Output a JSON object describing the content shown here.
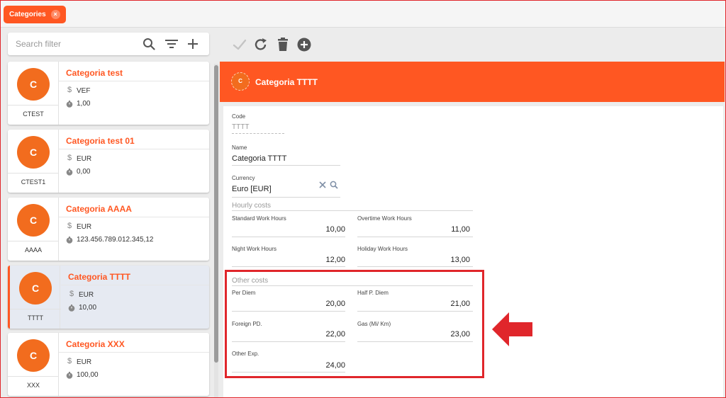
{
  "tab": {
    "label": "Categories",
    "close": "×"
  },
  "search": {
    "placeholder": "Search filter"
  },
  "toolbar": {
    "icons": [
      "check-icon",
      "refresh-icon",
      "trash-icon",
      "add-circle-icon"
    ]
  },
  "categories": [
    {
      "avatar": "C",
      "name": "Categoria test",
      "code": "CTEST",
      "currency": "VEF",
      "cost": "1,00"
    },
    {
      "avatar": "C",
      "name": "Categoria test 01",
      "code": "CTEST1",
      "currency": "EUR",
      "cost": "0,00"
    },
    {
      "avatar": "C",
      "name": "Categoria AAAA",
      "code": "AAAA",
      "currency": "EUR",
      "cost": "123.456.789.012.345,12"
    },
    {
      "avatar": "C",
      "name": "Categoria TTTT",
      "code": "TTTT",
      "currency": "EUR",
      "cost": "10,00"
    },
    {
      "avatar": "C",
      "name": "Categoria XXX",
      "code": "XXX",
      "currency": "EUR",
      "cost": "100,00"
    }
  ],
  "symbols": {
    "dollar": "$"
  },
  "detail": {
    "avatar": "C",
    "title": "Categoria TTTT",
    "code_label": "Code",
    "code_value": "TTTT",
    "name_label": "Name",
    "name_value": "Categoria TTTT",
    "currency_label": "Currency",
    "currency_value": "Euro [EUR]",
    "hourly_title": "Hourly costs",
    "standard_label": "Standard Work Hours",
    "standard_value": "10,00",
    "overtime_label": "Overtime Work Hours",
    "overtime_value": "11,00",
    "night_label": "Night Work Hours",
    "night_value": "12,00",
    "holiday_label": "Holiday Work Hours",
    "holiday_value": "13,00",
    "other_title": "Other costs",
    "perdiem_label": "Per Diem",
    "perdiem_value": "20,00",
    "halfperdiem_label": "Half P. Diem",
    "halfperdiem_value": "21,00",
    "foreign_label": "Foreign PD.",
    "foreign_value": "22,00",
    "gas_label": "Gas (Mi/ Km)",
    "gas_value": "23,00",
    "otherexp_label": "Other Exp.",
    "otherexp_value": "24,00"
  },
  "colors": {
    "accent": "#ff5722",
    "avatar": "#f26c1e",
    "selected_bg": "#e6eaf2",
    "annotation_red": "#e0262b"
  }
}
